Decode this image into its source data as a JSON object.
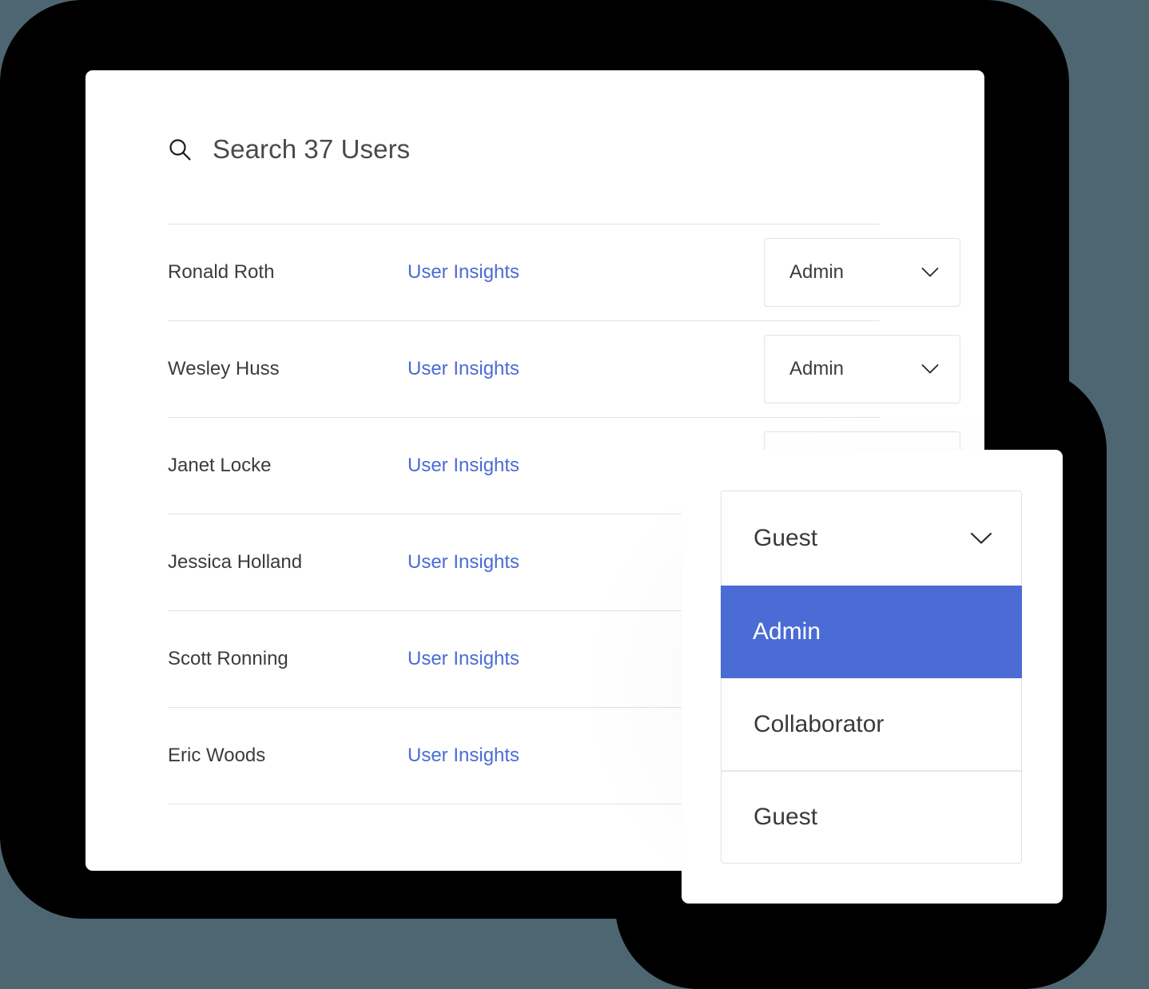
{
  "theme": {
    "page_background": "#4d6672",
    "backdrop": "#000000",
    "card_background": "#ffffff",
    "accent": "#4a6cd4",
    "link_color": "#4a6cd4",
    "text_primary": "#3c3c3c",
    "border": "#e2e2e2",
    "divider": "#e3e3e3"
  },
  "search": {
    "icon": "search-icon",
    "label": "Search 37 Users",
    "user_count": 37
  },
  "table": {
    "rows": [
      {
        "name": "Ronald Roth",
        "link_label": "User Insights",
        "role": "Admin",
        "role_visible": true
      },
      {
        "name": "Wesley Huss",
        "link_label": "User Insights",
        "role": "Admin",
        "role_visible": true
      },
      {
        "name": "Janet Locke",
        "link_label": "User Insights",
        "role": "",
        "role_visible": true
      },
      {
        "name": "Jessica Holland",
        "link_label": "User Insights",
        "role": "",
        "role_visible": false
      },
      {
        "name": "Scott Ronning",
        "link_label": "User Insights",
        "role": "",
        "role_visible": false
      },
      {
        "name": "Eric Woods",
        "link_label": "User Insights",
        "role": "",
        "role_visible": false
      }
    ]
  },
  "dropdown_panel": {
    "trigger": {
      "value": "Guest",
      "icon": "chevron-down-icon"
    },
    "options": [
      {
        "label": "Admin",
        "selected": true
      },
      {
        "label": "Collaborator",
        "selected": false
      },
      {
        "label": "Guest",
        "selected": false
      }
    ]
  }
}
